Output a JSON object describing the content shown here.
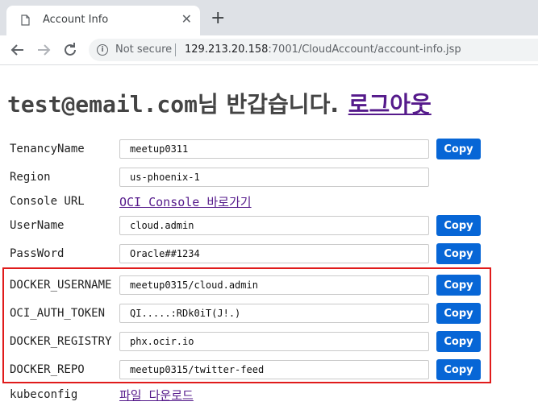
{
  "browser": {
    "tab_title": "Account Info",
    "new_tab_symbol": "+",
    "close_symbol": "✕",
    "security_text": "Not secure",
    "url_host": "129.213.20.158",
    "url_rest": ":7001/CloudAccount/account-info.jsp"
  },
  "page": {
    "greeting_email": "test@email.com",
    "greeting_suffix": "님 반갑습니다.",
    "logout_link": "로그아웃"
  },
  "fields": [
    {
      "label": "TenancyName",
      "value": "meetup0311",
      "copy": "Copy"
    },
    {
      "label": "Region",
      "value": "us-phoenix-1"
    },
    {
      "label": "Console URL",
      "link": "OCI Console 바로가기"
    },
    {
      "label": "UserName",
      "value": "cloud.admin",
      "copy": "Copy"
    },
    {
      "label": "PassWord",
      "value": "Oracle##1234",
      "copy": "Copy"
    },
    {
      "label": "DOCKER_USERNAME",
      "value": "meetup0315/cloud.admin",
      "copy": "Copy"
    },
    {
      "label": "OCI_AUTH_TOKEN",
      "value": "QI.....:RDk0iT(J!.)",
      "copy": "Copy"
    },
    {
      "label": "DOCKER_REGISTRY",
      "value": "phx.ocir.io",
      "copy": "Copy"
    },
    {
      "label": "DOCKER_REPO",
      "value": "meetup0315/twitter-feed",
      "copy": "Copy"
    },
    {
      "label": "kubeconfig",
      "link": "파일 다운로드"
    }
  ],
  "colors": {
    "copy_button": "#0766d6",
    "highlight_border": "#e01b1b",
    "link": "#551a8b"
  }
}
